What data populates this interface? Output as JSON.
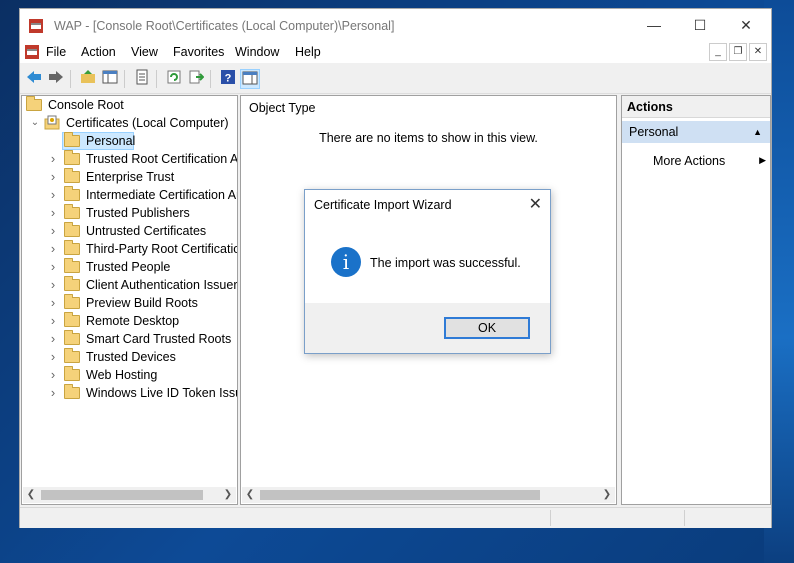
{
  "window": {
    "title": "WAP - [Console Root\\Certificates (Local Computer)\\Personal]",
    "minimize": "—",
    "maximize": "☐",
    "close": "✕"
  },
  "menu": {
    "items": [
      "File",
      "Action",
      "View",
      "Favorites",
      "Window",
      "Help"
    ]
  },
  "toolbar": {
    "icons": [
      "back-icon",
      "forward-icon",
      "up-folder-icon",
      "show-hide-tree-icon",
      "properties-icon",
      "refresh-icon",
      "export-list-icon",
      "help-icon",
      "show-hide-action-pane-icon"
    ]
  },
  "tree": {
    "root": "Console Root",
    "certificates": "Certificates (Local Computer)",
    "selected": "Personal",
    "items": [
      "Trusted Root Certification Au",
      "Enterprise Trust",
      "Intermediate Certification Au",
      "Trusted Publishers",
      "Untrusted Certificates",
      "Third-Party Root Certification",
      "Trusted People",
      "Client Authentication Issuers",
      "Preview Build Roots",
      "Remote Desktop",
      "Smart Card Trusted Roots",
      "Trusted Devices",
      "Web Hosting",
      "Windows Live ID Token Issue"
    ]
  },
  "center": {
    "column_header": "Object Type",
    "empty_message": "There are no items to show in this view."
  },
  "actions": {
    "header": "Actions",
    "section": "Personal",
    "more_actions": "More Actions"
  },
  "dialog": {
    "title": "Certificate Import Wizard",
    "message": "The import was successful.",
    "ok_label": "OK"
  },
  "colors": {
    "selection": "#cce8ff",
    "actions_section": "#cfe0f3",
    "info_icon": "#1a72c9",
    "ok_border": "#2f7bd6"
  }
}
